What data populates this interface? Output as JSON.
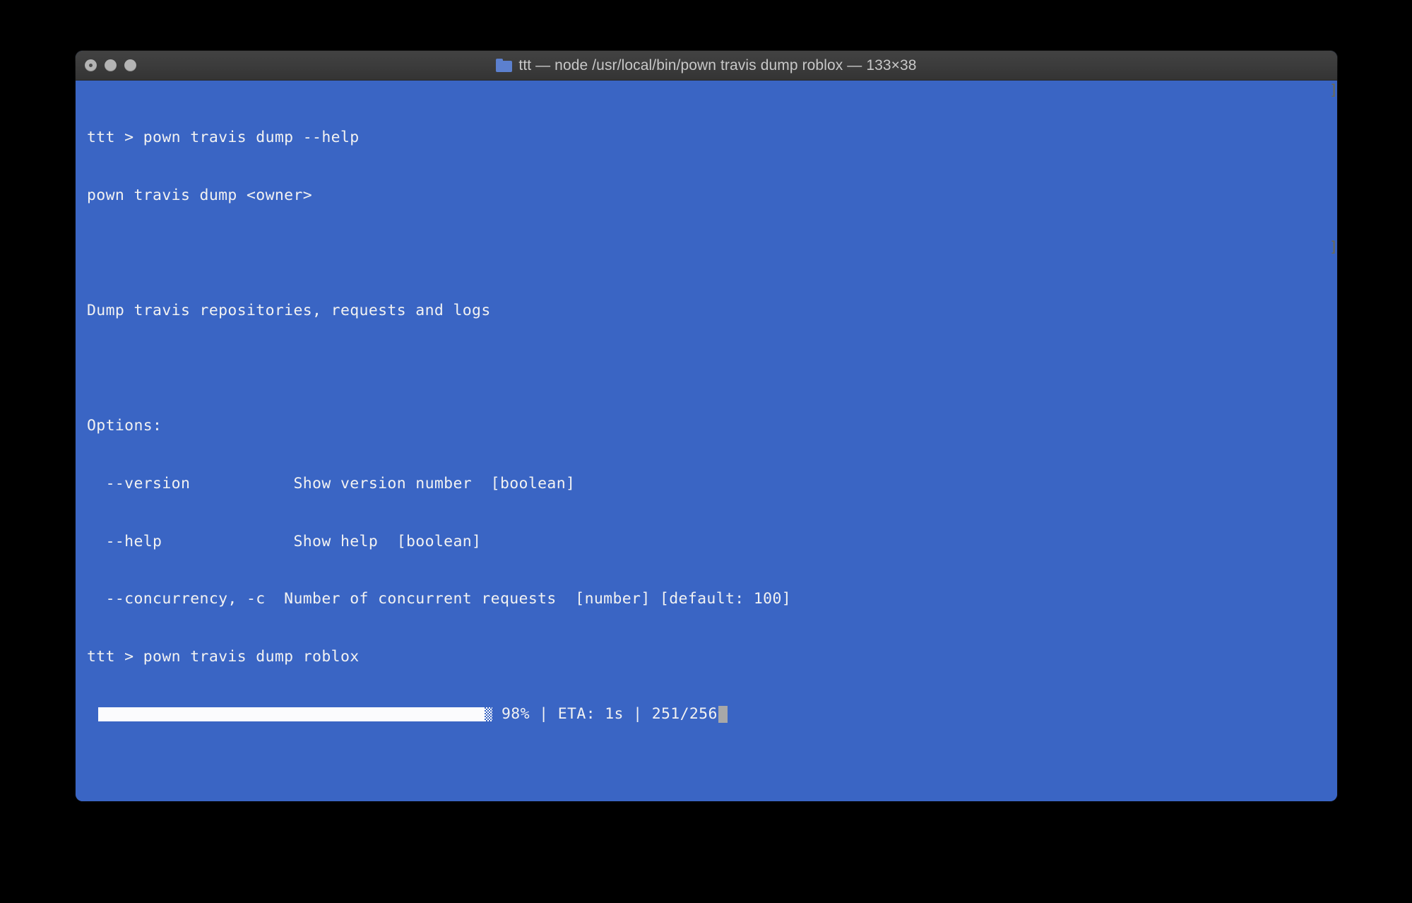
{
  "window": {
    "title": "ttt — node /usr/local/bin/pown travis dump roblox — 133×38",
    "folder_icon": "folder-icon",
    "columns": 133,
    "rows": 38,
    "traffic_lights": {
      "close": "close-button",
      "minimize": "minimize-button",
      "zoom": "zoom-button"
    }
  },
  "theme": {
    "background": "#3a65c4",
    "foreground": "#f2f2f2",
    "titlebar": "#3b3b3b",
    "title_text": "#c8c8c8",
    "cursor": "#a8a8a8",
    "progress_fill": "#fbfbfd"
  },
  "terminal": {
    "lines": [
      "ttt > pown travis dump --help",
      "pown travis dump <owner>",
      "",
      "Dump travis repositories, requests and logs",
      "",
      "Options:",
      "  --version           Show version number  [boolean]",
      "  --help              Show help  [boolean]",
      "  --concurrency, -c  Number of concurrent requests  [number] [default: 100]",
      "ttt > pown travis dump roblox"
    ],
    "progress": {
      "percent": 98,
      "percent_label": "98%",
      "eta_label": "ETA: 1s",
      "count_label": "251/256",
      "separator": "|",
      "status_text": "98% | ETA: 1s | 251/256",
      "completed": 251,
      "total": 256
    },
    "scroll_marks": [
      "]",
      "]"
    ]
  }
}
